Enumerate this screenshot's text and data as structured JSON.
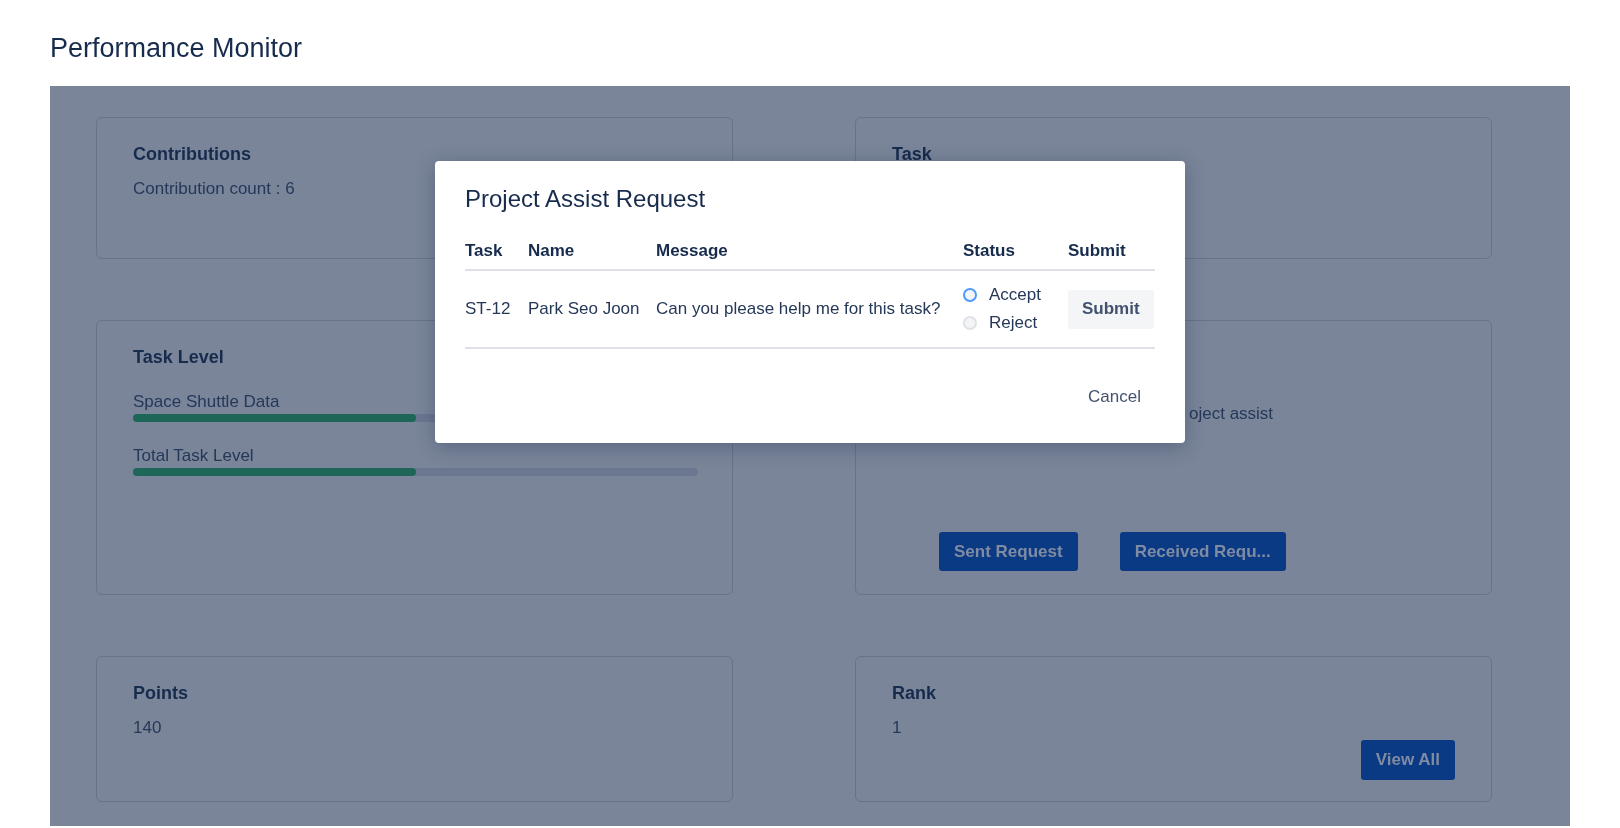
{
  "page": {
    "title": "Performance Monitor"
  },
  "cards": [
    {
      "kind": "text",
      "title": "Contributions",
      "lines": [
        "Contribution count : 6"
      ]
    },
    {
      "kind": "text",
      "title": "Task"
    },
    {
      "kind": "levels",
      "title": "Task Level",
      "bars": [
        {
          "label": "Space Shuttle Data",
          "level": 0.5
        },
        {
          "label": "Total Task Level",
          "level": 0.5
        }
      ]
    },
    {
      "kind": "requests",
      "text": "oject assist",
      "buttons": [
        "Sent Request",
        "Received Requ..."
      ]
    },
    {
      "kind": "text",
      "title": "Points",
      "lines": [
        "140"
      ]
    },
    {
      "kind": "text",
      "title": "Rank",
      "lines": [
        "1"
      ],
      "button": "View All"
    }
  ],
  "dialog": {
    "title": "Project Assist Request",
    "columns": [
      "Task",
      "Name",
      "Message",
      "Status",
      "Submit"
    ],
    "rows": [
      {
        "task": "ST-12",
        "name": "Park Seo Joon",
        "message": "Can you please help me for this task?",
        "options": [
          {
            "label": "Accept",
            "selected": false,
            "focused": true
          },
          {
            "label": "Reject",
            "selected": false,
            "focused": false
          }
        ],
        "submit": "Submit"
      }
    ],
    "cancel": "Cancel"
  }
}
